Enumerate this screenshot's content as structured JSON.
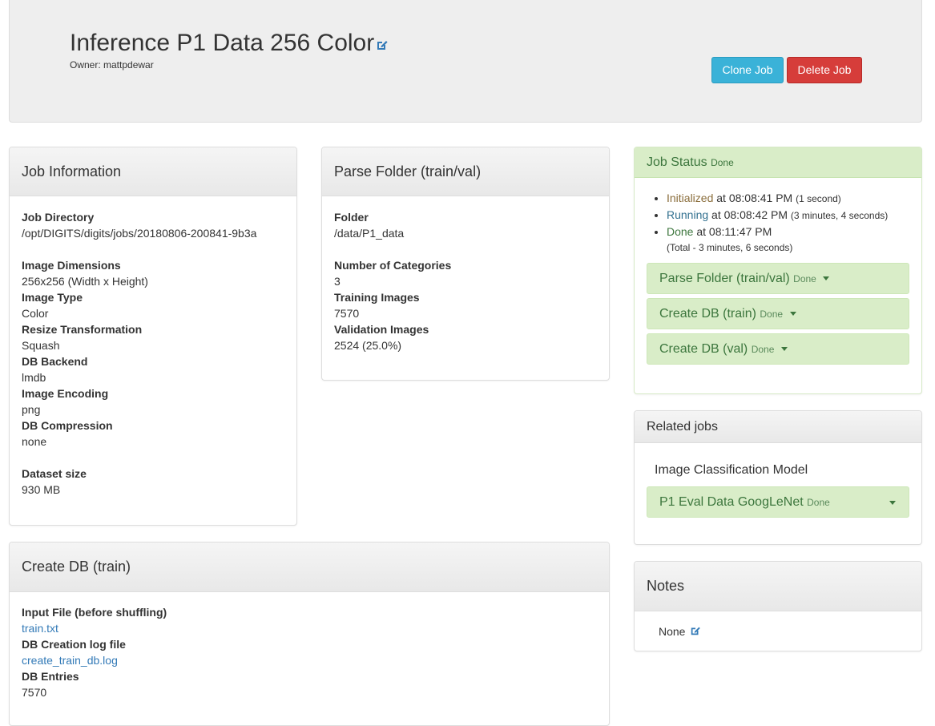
{
  "header": {
    "title": "Inference P1 Data 256 Color",
    "owner": "Owner: mattpdewar",
    "clone_label": "Clone Job",
    "delete_label": "Delete Job"
  },
  "job_info": {
    "heading": "Job Information",
    "job_dir_label": "Job Directory",
    "job_dir": "/opt/DIGITS/digits/jobs/20180806-200841-9b3a",
    "dims_label": "Image Dimensions",
    "dims": "256x256 (Width x Height)",
    "type_label": "Image Type",
    "type": "Color",
    "resize_label": "Resize Transformation",
    "resize": "Squash",
    "backend_label": "DB Backend",
    "backend": "lmdb",
    "encoding_label": "Image Encoding",
    "encoding": "png",
    "compression_label": "DB Compression",
    "compression": "none",
    "size_label": "Dataset size",
    "size": "930 MB"
  },
  "parse": {
    "heading": "Parse Folder (train/val)",
    "folder_label": "Folder",
    "folder": "/data/P1_data",
    "categories_label": "Number of Categories",
    "categories": "3",
    "train_label": "Training Images",
    "train": "7570",
    "val_label": "Validation Images",
    "val": "2524 (25.0%)"
  },
  "create_db": {
    "heading": "Create DB (train)",
    "input_label": "Input File (before shuffling)",
    "input_file": "train.txt",
    "log_label": "DB Creation log file",
    "log_file": "create_train_db.log",
    "entries_label": "DB Entries",
    "entries": "7570"
  },
  "status": {
    "heading": "Job Status",
    "heading_state": "Done",
    "init_label": "Initialized",
    "init_time": " at 08:08:41 PM ",
    "init_dur": "(1 second)",
    "running_label": "Running",
    "running_time": " at 08:08:42 PM ",
    "running_dur": "(3 minutes, 4 seconds)",
    "done_label": "Done",
    "done_time": " at 08:11:47 PM",
    "total": "(Total - 3 minutes, 6 seconds)",
    "subjobs": [
      {
        "label": "Parse Folder (train/val)",
        "state": "Done"
      },
      {
        "label": "Create DB (train)",
        "state": "Done"
      },
      {
        "label": "Create DB (val)",
        "state": "Done"
      }
    ]
  },
  "related": {
    "heading": "Related jobs",
    "model_type": "Image Classification Model",
    "job_label": "P1 Eval Data GoogLeNet",
    "job_state": "Done"
  },
  "notes": {
    "heading": "Notes",
    "value": "None"
  },
  "colors": {
    "clone": "#3ab2d8",
    "delete": "#d63d3a",
    "success_bg": "#d9edc8",
    "success_text": "#3c763d",
    "link": "#337ab7"
  }
}
